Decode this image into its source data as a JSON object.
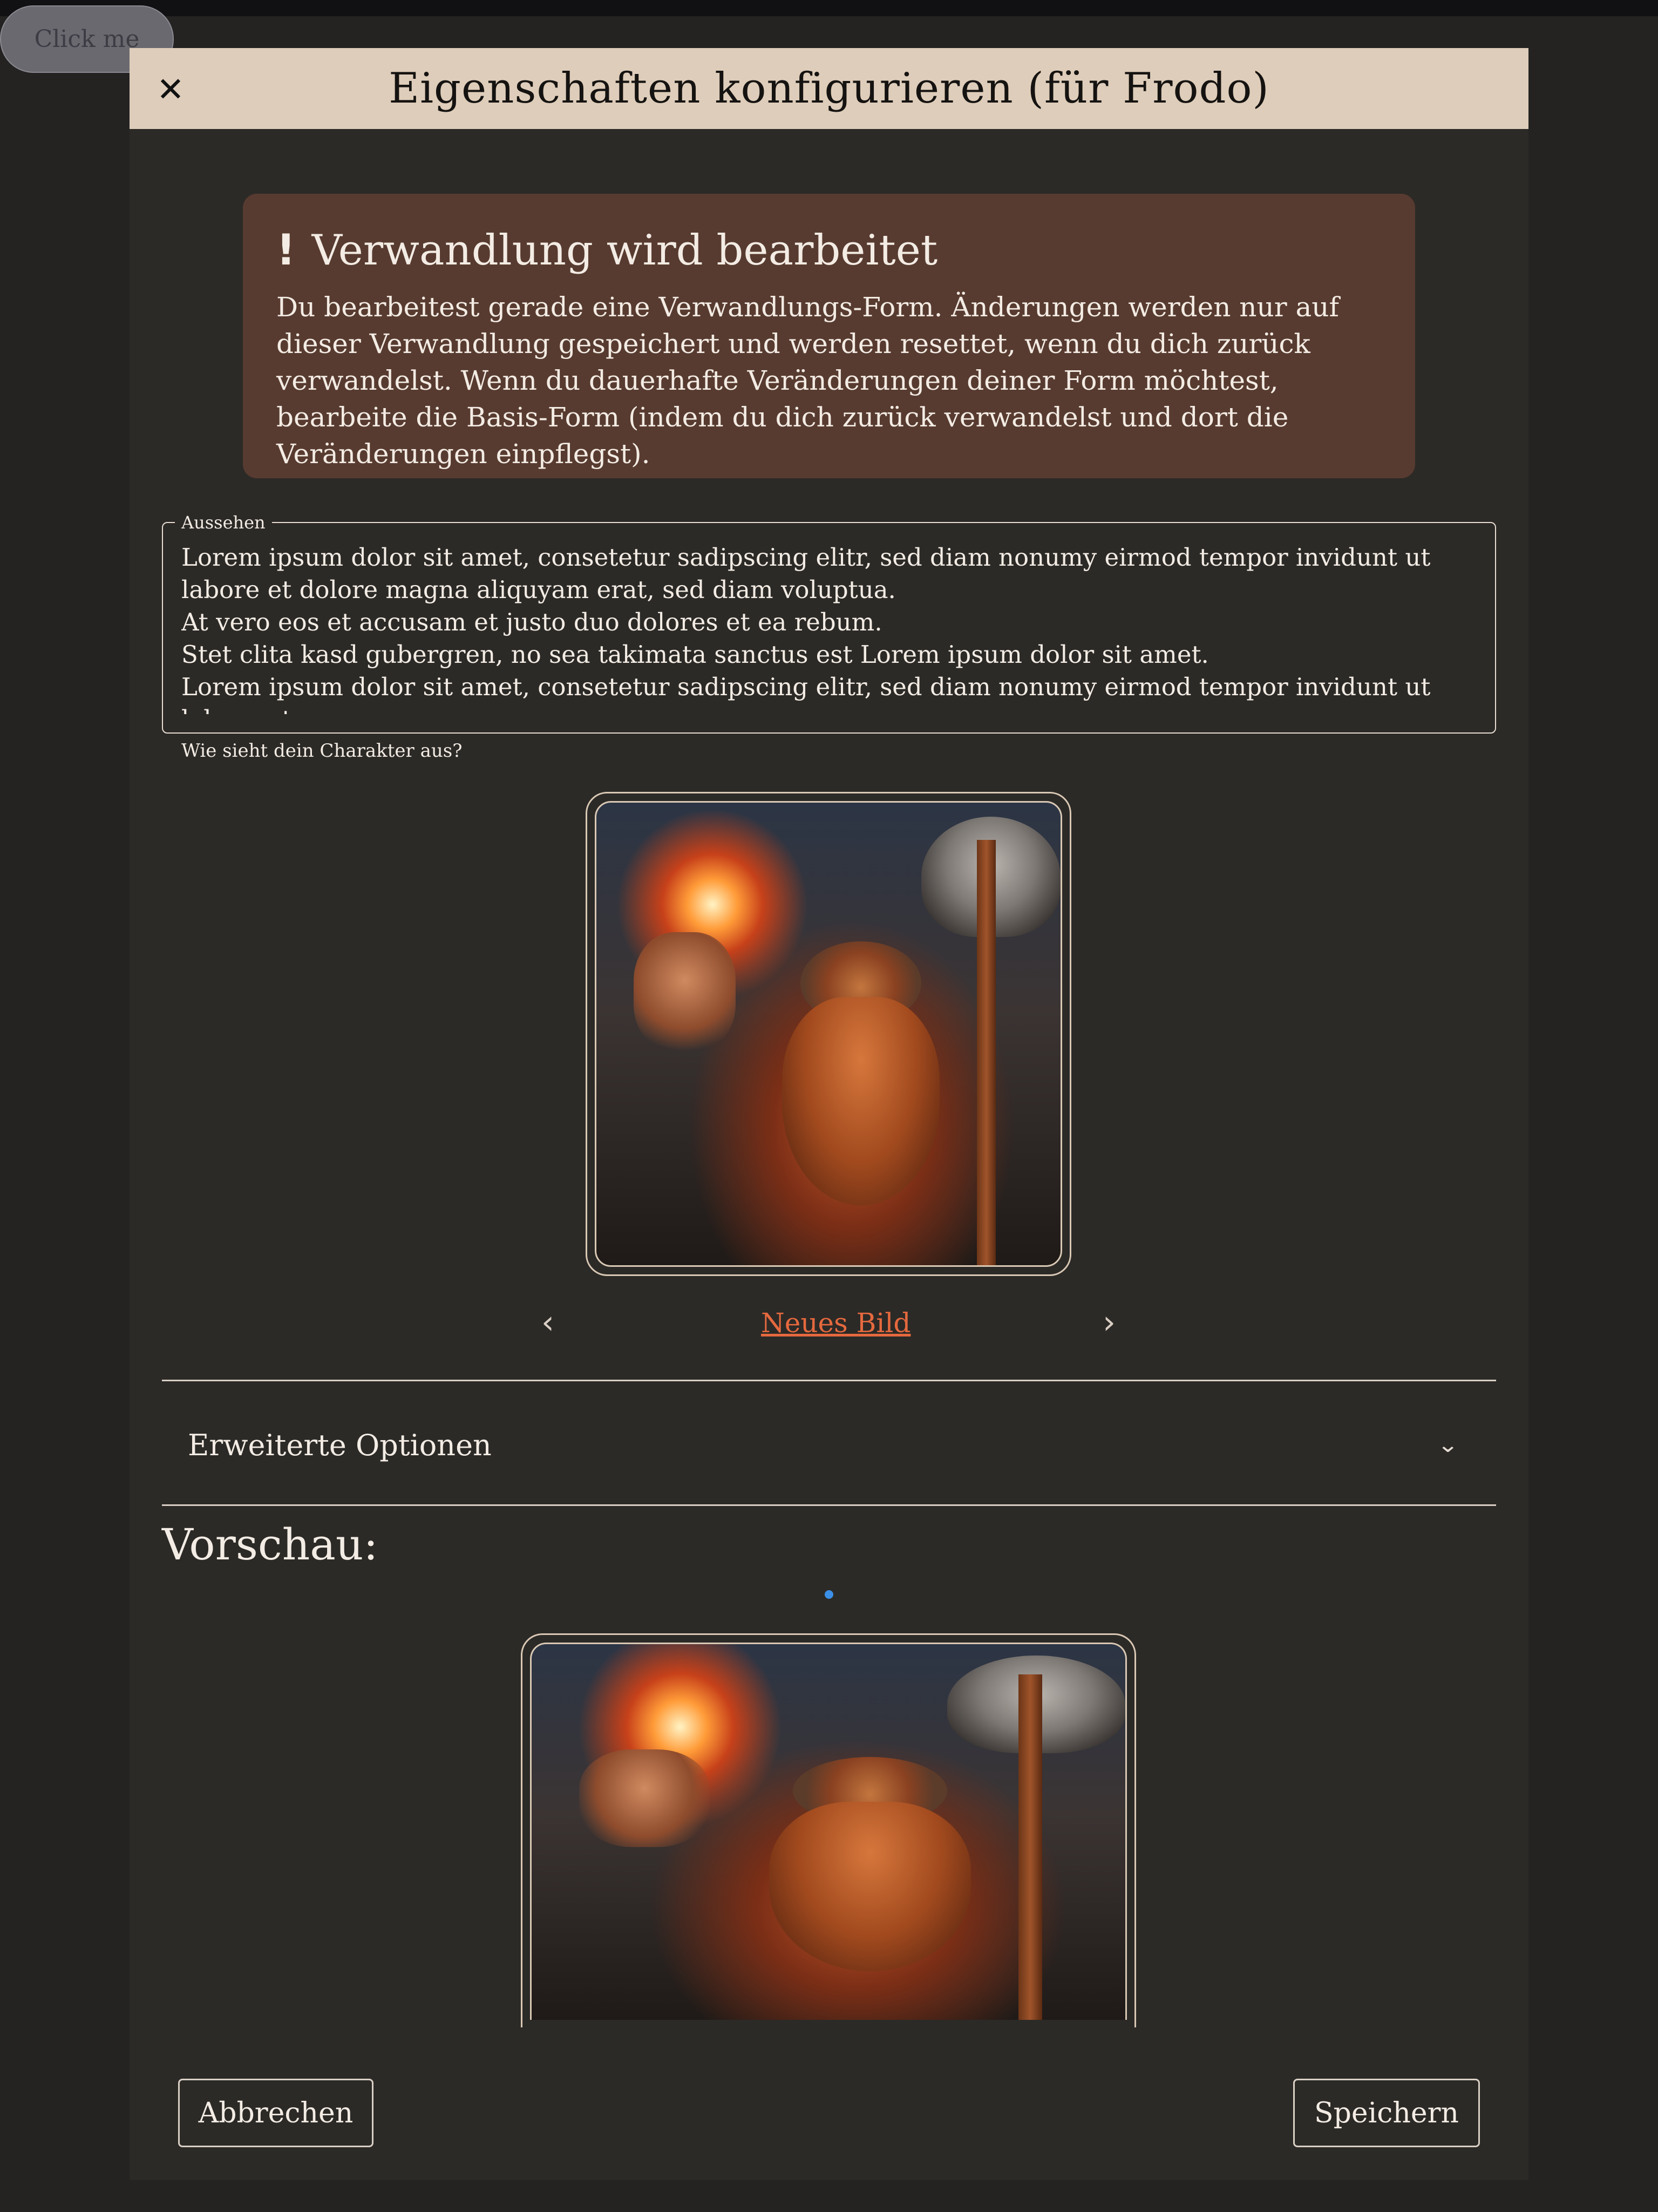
{
  "background_button": {
    "label": "Click me"
  },
  "dialog": {
    "title": "Eigenschaften konfigurieren (für Frodo)",
    "close_icon": "close-icon",
    "warning": {
      "icon": "exclamation-icon",
      "icon_glyph": "!",
      "title": "Verwandlung wird bearbeitet",
      "text": "Du bearbeitest gerade eine Verwandlungs-Form. Änderungen werden nur auf dieser Verwandlung gespeichert und werden resettet, wenn du dich zurück verwandelst. Wenn du dauerhafte Veränderungen deiner Form möchtest, bearbeite die Basis-Form (indem du dich zurück verwandelst und dort die Veränderungen einpflegst)."
    },
    "appearance": {
      "label": "Aussehen",
      "value": "Lorem ipsum dolor sit amet, consetetur sadipscing elitr, sed diam nonumy eirmod tempor invidunt ut labore et dolore magna aliquyam erat, sed diam voluptua.\nAt vero eos et accusam et justo duo dolores et ea rebum.\nStet clita kasd gubergren, no sea takimata sanctus est Lorem ipsum dolor sit amet.\nLorem ipsum dolor sit amet, consetetur sadipscing elitr, sed diam nonumy eirmod tempor invidunt ut labore et",
      "helper": "Wie sieht dein Charakter aus?"
    },
    "image_nav": {
      "prev_icon": "‹",
      "new_image": "Neues Bild",
      "next_icon": "›"
    },
    "advanced": {
      "label": "Erweiterte Optionen",
      "chevron": "⌄"
    },
    "preview": {
      "title": "Vorschau:"
    },
    "buttons": {
      "cancel": "Abbrechen",
      "save": "Speichern"
    }
  },
  "colors": {
    "header_bg": "#decdba",
    "dialog_bg": "#2c2a27",
    "warning_bg": "#583b30",
    "link": "#e5693e",
    "loading_dot": "#3b8fe6"
  }
}
